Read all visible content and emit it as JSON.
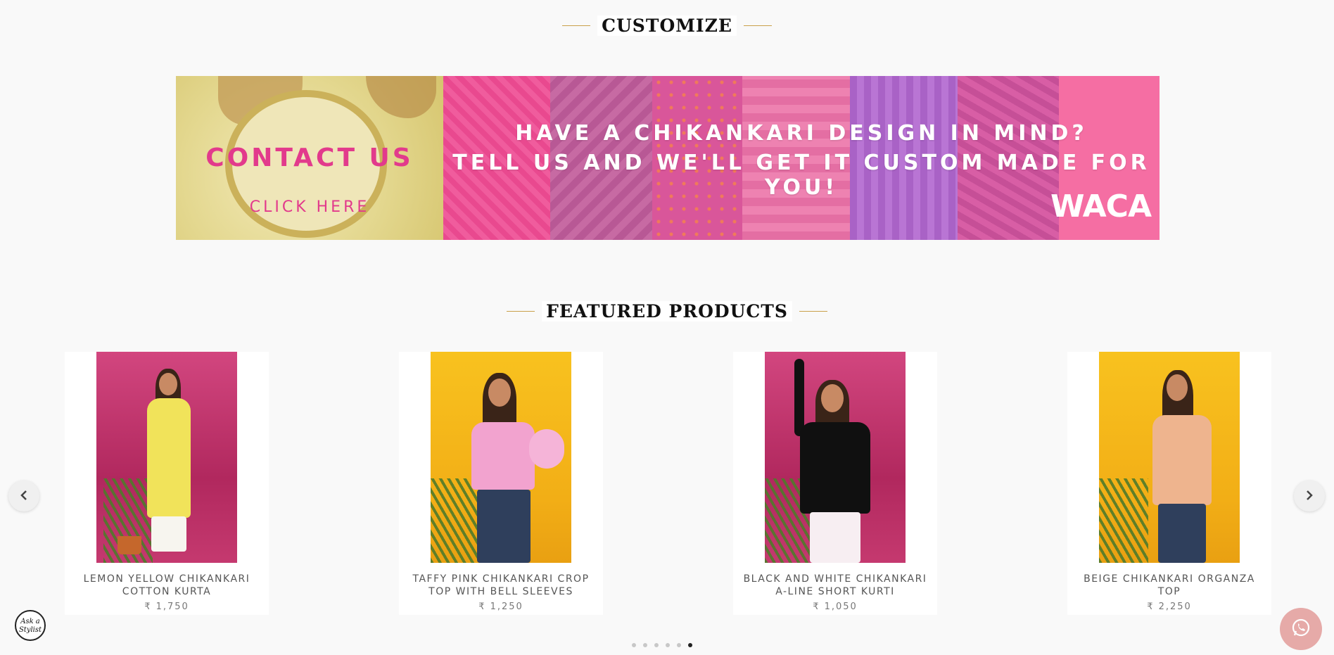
{
  "customize": {
    "title": "CUSTOMIZE"
  },
  "banner": {
    "contact_title": "CONTACT US",
    "click_here": "CLICK HERE",
    "line1": "HAVE A CHIKANKARI DESIGN IN MIND?",
    "line2": "TELL US AND WE'LL GET IT CUSTOM MADE FOR YOU!",
    "logo": "WACA"
  },
  "featured": {
    "title": "FEATURED PRODUCTS"
  },
  "products": [
    {
      "name": "LEMON YELLOW CHIKANKARI COTTON KURTA",
      "price": "₹ 1,750"
    },
    {
      "name": "TAFFY PINK CHIKANKARI CROP TOP WITH BELL SLEEVES",
      "price": "₹ 1,250"
    },
    {
      "name": "BLACK AND WHITE CHIKANKARI A-LINE SHORT KURTI",
      "price": "₹ 1,050"
    },
    {
      "name": "BEIGE CHIKANKARI ORGANZA TOP",
      "price": "₹ 2,250"
    }
  ],
  "carousel": {
    "dot_count": 6,
    "active_dot": 6
  },
  "stylist": {
    "label": "Ask a Stylist"
  },
  "icons": {
    "prev": "chevron-left-icon",
    "next": "chevron-right-icon",
    "chat": "whatsapp-icon"
  },
  "colors": {
    "accent": "#c9a04a",
    "pink_text": "#e23a8c",
    "whatsapp_bg": "#e6aaa8"
  }
}
